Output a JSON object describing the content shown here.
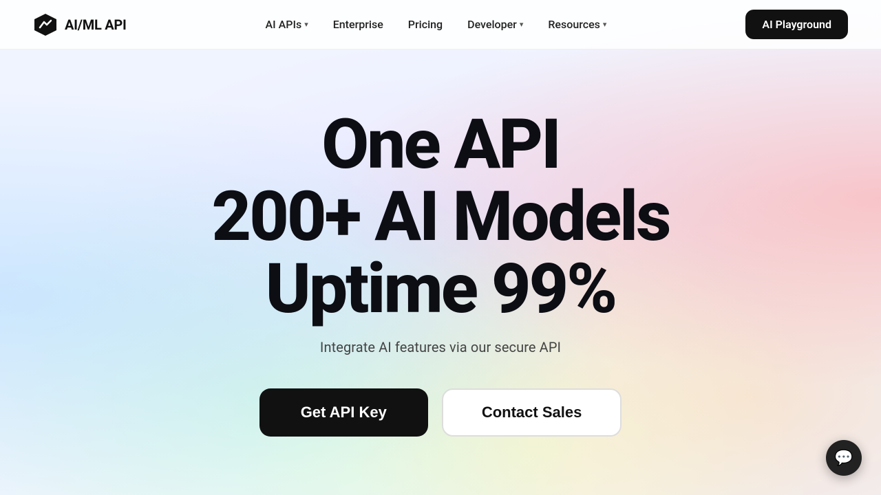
{
  "brand": {
    "logo_text": "AI/ML API",
    "logo_icon": "chart-icon"
  },
  "nav": {
    "links": [
      {
        "label": "AI APIs",
        "has_dropdown": true,
        "id": "ai-apis"
      },
      {
        "label": "Enterprise",
        "has_dropdown": false,
        "id": "enterprise"
      },
      {
        "label": "Pricing",
        "has_dropdown": false,
        "id": "pricing"
      },
      {
        "label": "Developer",
        "has_dropdown": true,
        "id": "developer"
      },
      {
        "label": "Resources",
        "has_dropdown": true,
        "id": "resources"
      }
    ],
    "cta_label": "AI Playground"
  },
  "hero": {
    "line1": "One API",
    "line2": "200+ AI Models",
    "line3": "Uptime 99%",
    "subtitle": "Integrate AI features via our secure API",
    "btn_primary": "Get API Key",
    "btn_secondary": "Contact Sales"
  },
  "chat_widget": {
    "icon": "💬"
  }
}
